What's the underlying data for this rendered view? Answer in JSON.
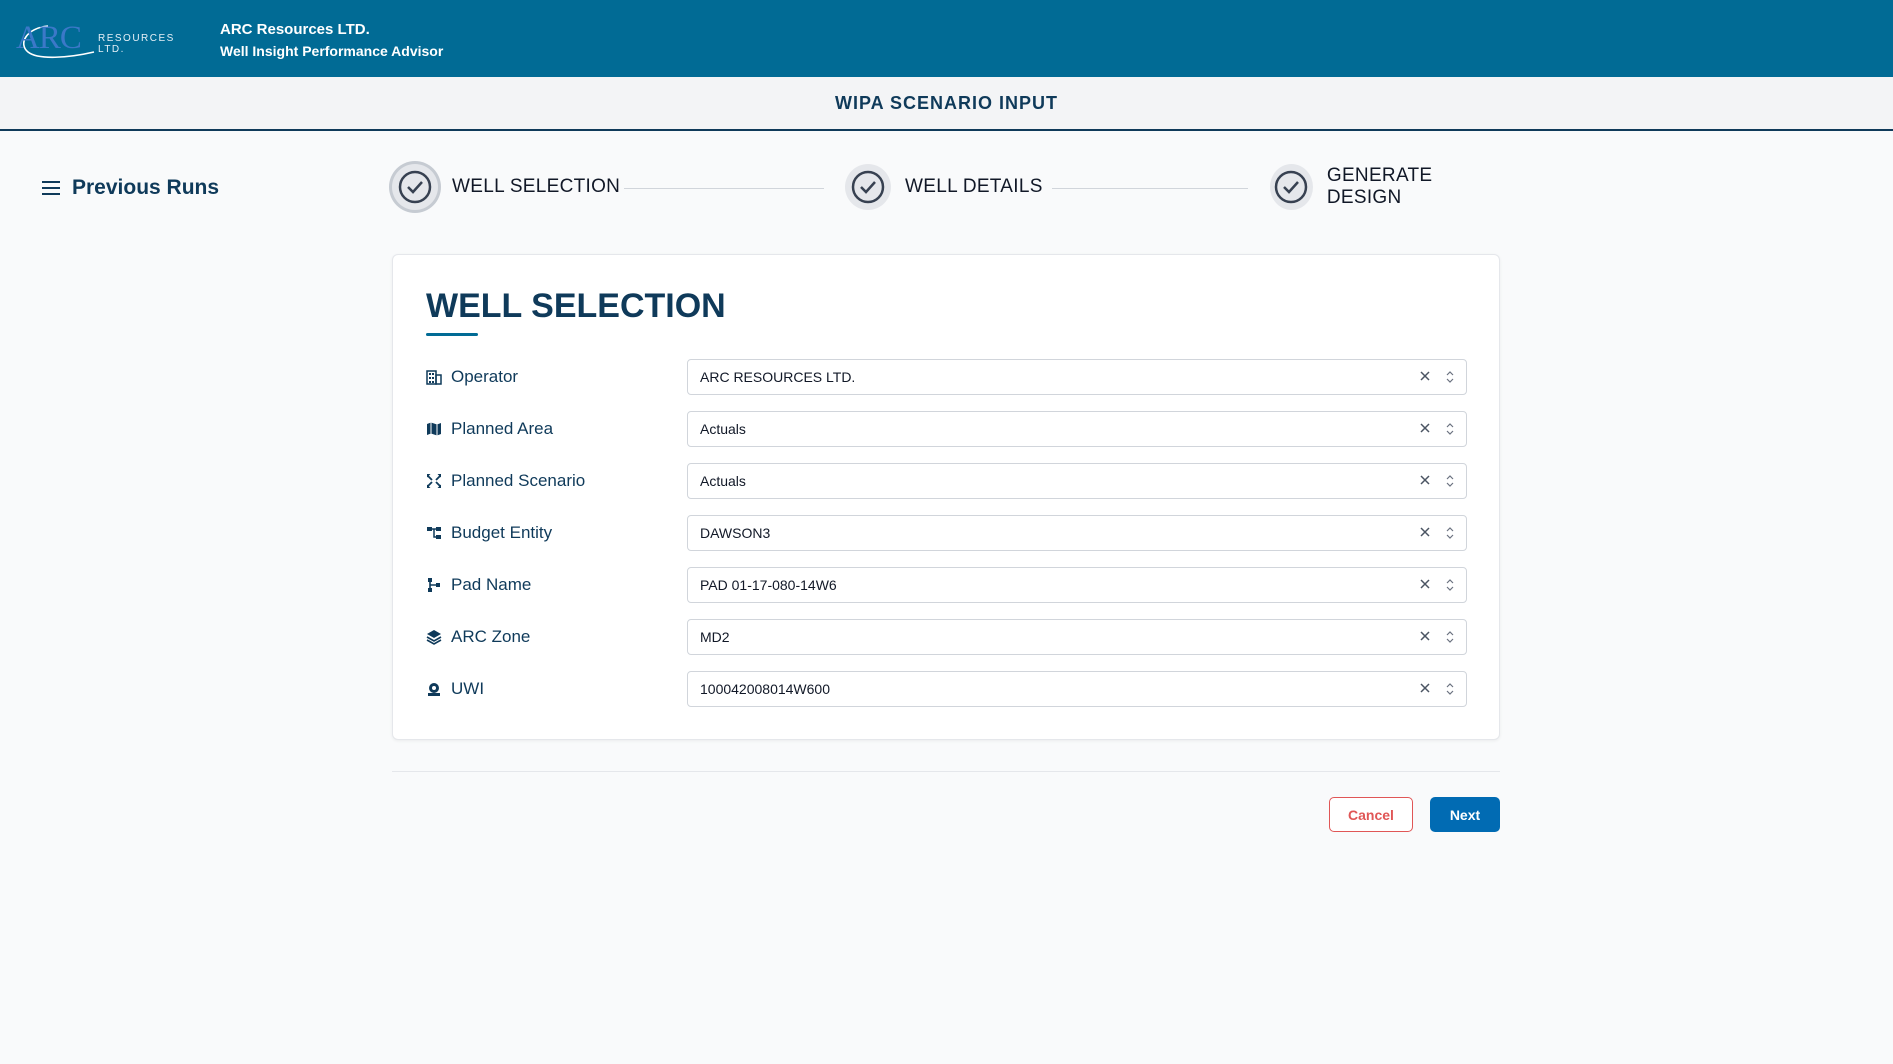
{
  "header": {
    "logo_mark": "ARC",
    "logo_sub": "RESOURCES LTD.",
    "company": "ARC Resources LTD.",
    "app_name": "Well Insight Performance Advisor"
  },
  "subheader": {
    "title": "WIPA SCENARIO INPUT"
  },
  "sidebar": {
    "previous_runs": "Previous Runs"
  },
  "stepper": {
    "steps": [
      {
        "label": "WELL SELECTION"
      },
      {
        "label": "WELL DETAILS"
      },
      {
        "label": "GENERATE DESIGN"
      }
    ]
  },
  "card": {
    "title": "WELL SELECTION",
    "fields": [
      {
        "label": "Operator",
        "value": "ARC RESOURCES LTD.",
        "icon": "building-icon"
      },
      {
        "label": "Planned Area",
        "value": "Actuals",
        "icon": "map-icon"
      },
      {
        "label": "Planned Scenario",
        "value": "Actuals",
        "icon": "arrows-cross-icon"
      },
      {
        "label": "Budget Entity",
        "value": "DAWSON3",
        "icon": "hierarchy-icon"
      },
      {
        "label": "Pad Name",
        "value": "PAD 01-17-080-14W6",
        "icon": "branch-icon"
      },
      {
        "label": "ARC Zone",
        "value": "MD2",
        "icon": "layers-icon"
      },
      {
        "label": "UWI",
        "value": "100042008014W600",
        "icon": "well-icon"
      }
    ]
  },
  "actions": {
    "cancel": "Cancel",
    "next": "Next"
  },
  "colors": {
    "header_bg": "#016b95",
    "primary_text": "#0f3a5a",
    "next_button": "#016bb3",
    "cancel_border": "#e05656"
  }
}
